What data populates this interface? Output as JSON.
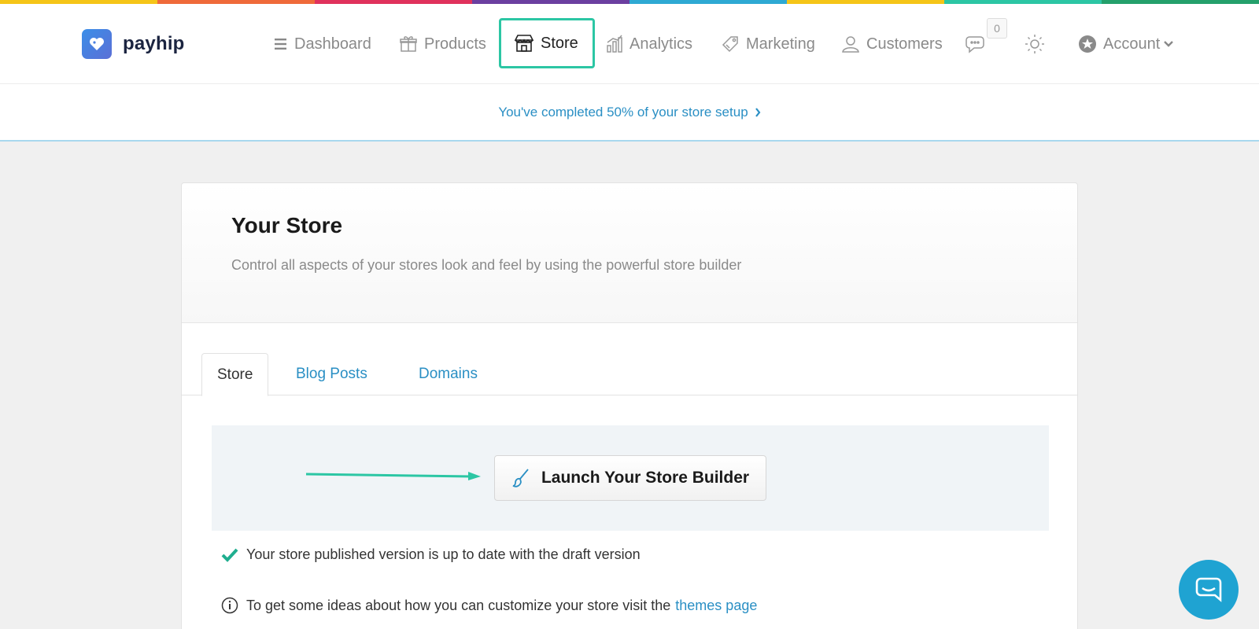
{
  "rainbow_colors": [
    "#f5c518",
    "#ef6a3a",
    "#e0315c",
    "#6b3fa0",
    "#2ea9d3",
    "#f5c518",
    "#2cc6a4",
    "#24a06b"
  ],
  "brand": {
    "name": "payhip",
    "logo_icon": "heart-tag-icon"
  },
  "nav": {
    "items": [
      {
        "label": "Dashboard",
        "icon": "menu-icon"
      },
      {
        "label": "Products",
        "icon": "gift-icon"
      },
      {
        "label": "Store",
        "icon": "store-icon",
        "active": true
      },
      {
        "label": "Analytics",
        "icon": "chart-icon"
      },
      {
        "label": "Marketing",
        "icon": "tag-icon"
      },
      {
        "label": "Customers",
        "icon": "user-icon"
      }
    ],
    "messages_count": "0",
    "theme_icon": "sun-icon",
    "account_label": "Account"
  },
  "setup_banner": {
    "text": "You've completed 50% of your store setup",
    "percent": 50
  },
  "store_card": {
    "title": "Your Store",
    "subtitle": "Control all aspects of your stores look and feel by using the powerful store builder",
    "tabs": [
      "Store",
      "Blog Posts",
      "Domains"
    ],
    "launch_label": "Launch Your Store Builder",
    "status_text": "Your store published version is up to date with the draft version",
    "info_text": "To get some ideas about how you can customize your store visit the",
    "themes_link": "themes page"
  },
  "colors": {
    "accent": "#2cc6a4",
    "link": "#2a8fc4",
    "help": "#1fa3d2"
  }
}
